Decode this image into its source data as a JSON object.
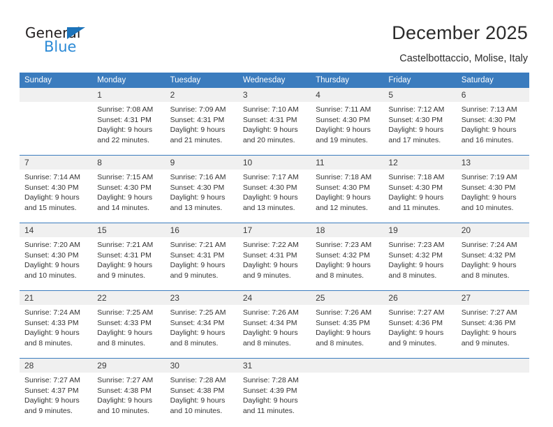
{
  "brand": {
    "name_top": "General",
    "name_bottom": "Blue",
    "accent_color": "#2b8ad6",
    "triangle_color": "#1c73ba"
  },
  "header": {
    "title": "December 2025",
    "subtitle": "Castelbottaccio, Molise, Italy"
  },
  "theme": {
    "header_bg": "#3b7cbe",
    "header_text": "#ffffff",
    "daynum_bg": "#f0f0f0",
    "separator": "#3b7cbe",
    "body_text": "#333333"
  },
  "weekday_headers": [
    "Sunday",
    "Monday",
    "Tuesday",
    "Wednesday",
    "Thursday",
    "Friday",
    "Saturday"
  ],
  "weeks": [
    {
      "days": [
        {
          "num": "",
          "info": ""
        },
        {
          "num": "1",
          "info": "Sunrise: 7:08 AM\nSunset: 4:31 PM\nDaylight: 9 hours\nand 22 minutes."
        },
        {
          "num": "2",
          "info": "Sunrise: 7:09 AM\nSunset: 4:31 PM\nDaylight: 9 hours\nand 21 minutes."
        },
        {
          "num": "3",
          "info": "Sunrise: 7:10 AM\nSunset: 4:31 PM\nDaylight: 9 hours\nand 20 minutes."
        },
        {
          "num": "4",
          "info": "Sunrise: 7:11 AM\nSunset: 4:30 PM\nDaylight: 9 hours\nand 19 minutes."
        },
        {
          "num": "5",
          "info": "Sunrise: 7:12 AM\nSunset: 4:30 PM\nDaylight: 9 hours\nand 17 minutes."
        },
        {
          "num": "6",
          "info": "Sunrise: 7:13 AM\nSunset: 4:30 PM\nDaylight: 9 hours\nand 16 minutes."
        }
      ]
    },
    {
      "days": [
        {
          "num": "7",
          "info": "Sunrise: 7:14 AM\nSunset: 4:30 PM\nDaylight: 9 hours\nand 15 minutes."
        },
        {
          "num": "8",
          "info": "Sunrise: 7:15 AM\nSunset: 4:30 PM\nDaylight: 9 hours\nand 14 minutes."
        },
        {
          "num": "9",
          "info": "Sunrise: 7:16 AM\nSunset: 4:30 PM\nDaylight: 9 hours\nand 13 minutes."
        },
        {
          "num": "10",
          "info": "Sunrise: 7:17 AM\nSunset: 4:30 PM\nDaylight: 9 hours\nand 13 minutes."
        },
        {
          "num": "11",
          "info": "Sunrise: 7:18 AM\nSunset: 4:30 PM\nDaylight: 9 hours\nand 12 minutes."
        },
        {
          "num": "12",
          "info": "Sunrise: 7:18 AM\nSunset: 4:30 PM\nDaylight: 9 hours\nand 11 minutes."
        },
        {
          "num": "13",
          "info": "Sunrise: 7:19 AM\nSunset: 4:30 PM\nDaylight: 9 hours\nand 10 minutes."
        }
      ]
    },
    {
      "days": [
        {
          "num": "14",
          "info": "Sunrise: 7:20 AM\nSunset: 4:30 PM\nDaylight: 9 hours\nand 10 minutes."
        },
        {
          "num": "15",
          "info": "Sunrise: 7:21 AM\nSunset: 4:31 PM\nDaylight: 9 hours\nand 9 minutes."
        },
        {
          "num": "16",
          "info": "Sunrise: 7:21 AM\nSunset: 4:31 PM\nDaylight: 9 hours\nand 9 minutes."
        },
        {
          "num": "17",
          "info": "Sunrise: 7:22 AM\nSunset: 4:31 PM\nDaylight: 9 hours\nand 9 minutes."
        },
        {
          "num": "18",
          "info": "Sunrise: 7:23 AM\nSunset: 4:32 PM\nDaylight: 9 hours\nand 8 minutes."
        },
        {
          "num": "19",
          "info": "Sunrise: 7:23 AM\nSunset: 4:32 PM\nDaylight: 9 hours\nand 8 minutes."
        },
        {
          "num": "20",
          "info": "Sunrise: 7:24 AM\nSunset: 4:32 PM\nDaylight: 9 hours\nand 8 minutes."
        }
      ]
    },
    {
      "days": [
        {
          "num": "21",
          "info": "Sunrise: 7:24 AM\nSunset: 4:33 PM\nDaylight: 9 hours\nand 8 minutes."
        },
        {
          "num": "22",
          "info": "Sunrise: 7:25 AM\nSunset: 4:33 PM\nDaylight: 9 hours\nand 8 minutes."
        },
        {
          "num": "23",
          "info": "Sunrise: 7:25 AM\nSunset: 4:34 PM\nDaylight: 9 hours\nand 8 minutes."
        },
        {
          "num": "24",
          "info": "Sunrise: 7:26 AM\nSunset: 4:34 PM\nDaylight: 9 hours\nand 8 minutes."
        },
        {
          "num": "25",
          "info": "Sunrise: 7:26 AM\nSunset: 4:35 PM\nDaylight: 9 hours\nand 8 minutes."
        },
        {
          "num": "26",
          "info": "Sunrise: 7:27 AM\nSunset: 4:36 PM\nDaylight: 9 hours\nand 9 minutes."
        },
        {
          "num": "27",
          "info": "Sunrise: 7:27 AM\nSunset: 4:36 PM\nDaylight: 9 hours\nand 9 minutes."
        }
      ]
    },
    {
      "days": [
        {
          "num": "28",
          "info": "Sunrise: 7:27 AM\nSunset: 4:37 PM\nDaylight: 9 hours\nand 9 minutes."
        },
        {
          "num": "29",
          "info": "Sunrise: 7:27 AM\nSunset: 4:38 PM\nDaylight: 9 hours\nand 10 minutes."
        },
        {
          "num": "30",
          "info": "Sunrise: 7:28 AM\nSunset: 4:38 PM\nDaylight: 9 hours\nand 10 minutes."
        },
        {
          "num": "31",
          "info": "Sunrise: 7:28 AM\nSunset: 4:39 PM\nDaylight: 9 hours\nand 11 minutes."
        },
        {
          "num": "",
          "info": ""
        },
        {
          "num": "",
          "info": ""
        },
        {
          "num": "",
          "info": ""
        }
      ]
    }
  ]
}
